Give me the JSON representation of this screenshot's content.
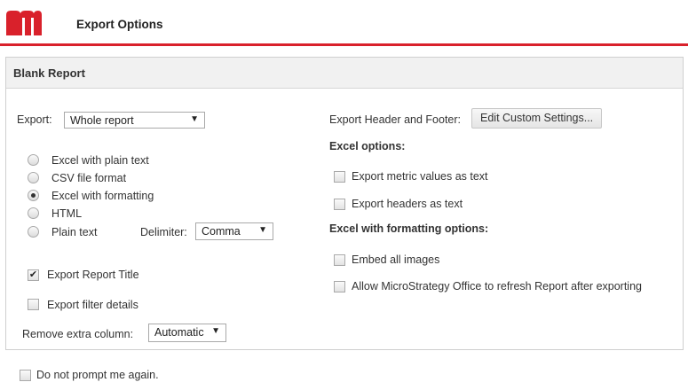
{
  "header": {
    "title": "Export Options",
    "brand_color": "#d9212b"
  },
  "panel": {
    "title": "Blank Report"
  },
  "export": {
    "label": "Export:",
    "selected": "Whole report",
    "formats": [
      {
        "label": "Excel with plain text",
        "selected": false
      },
      {
        "label": "CSV file format",
        "selected": false
      },
      {
        "label": "Excel with formatting",
        "selected": true
      },
      {
        "label": "HTML",
        "selected": false
      },
      {
        "label": "Plain text",
        "selected": false
      }
    ],
    "delimiter_label": "Delimiter:",
    "delimiter_value": "Comma",
    "export_report_title": {
      "label": "Export Report Title",
      "checked": true
    },
    "export_filter_details": {
      "label": "Export filter details",
      "checked": false
    },
    "remove_extra_column_label": "Remove extra column:",
    "remove_extra_column_value": "Automatic"
  },
  "header_footer": {
    "label": "Export Header and Footer:",
    "button": "Edit Custom Settings..."
  },
  "excel_options": {
    "title": "Excel options:",
    "items": [
      {
        "label": "Export metric values as text",
        "checked": false
      },
      {
        "label": "Export headers as text",
        "checked": false
      }
    ]
  },
  "excel_formatting_options": {
    "title": "Excel with formatting options:",
    "items": [
      {
        "label": "Embed all images",
        "checked": false
      },
      {
        "label": "Allow MicroStrategy Office to refresh Report after exporting",
        "checked": false
      }
    ]
  },
  "footer": {
    "dont_prompt": {
      "label": "Do not prompt me again.",
      "checked": false
    }
  }
}
